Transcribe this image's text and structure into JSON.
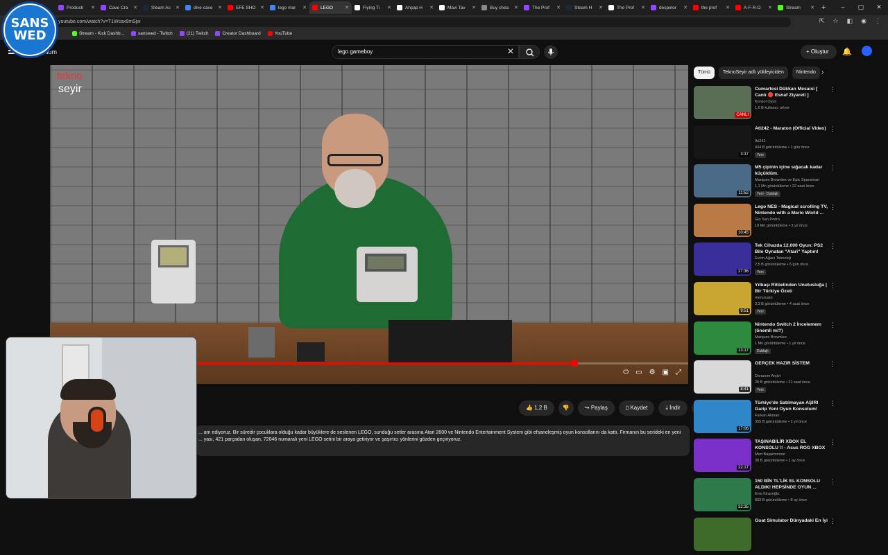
{
  "browser": {
    "tabs": [
      {
        "label": "Producti",
        "color": "#9146ff"
      },
      {
        "label": "Cave Cra",
        "color": "#9146ff"
      },
      {
        "label": "Steam Ac",
        "color": "#1b2838"
      },
      {
        "label": "dive cave",
        "color": "#4285f4"
      },
      {
        "label": "EFE SHO",
        "color": "#ff0000"
      },
      {
        "label": "lego mar",
        "color": "#4285f4"
      },
      {
        "label": "LEGO",
        "color": "#ff0000"
      },
      {
        "label": "Flying Ti",
        "color": "#ffffff"
      },
      {
        "label": "Ahşap H",
        "color": "#ffffff"
      },
      {
        "label": "Mavi Tav",
        "color": "#ffffff"
      },
      {
        "label": "Buy chea",
        "color": "#888888"
      },
      {
        "label": "The Prof",
        "color": "#9146ff"
      },
      {
        "label": "Steam H",
        "color": "#1b2838"
      },
      {
        "label": "The Prof",
        "color": "#ffffff"
      },
      {
        "label": "despelor",
        "color": "#9146ff"
      },
      {
        "label": "the prof",
        "color": "#ff0000"
      },
      {
        "label": "A-F-R-O",
        "color": "#ff0000"
      },
      {
        "label": "Stream",
        "color": "#53fc18"
      }
    ],
    "active_tab_index": 6,
    "url": "youtube.com/watch?v=T1Wcax9mSjw",
    "bookmarks": [
      {
        "label": "Stream - Kick Dashb...",
        "color": "#53fc18"
      },
      {
        "label": "sanswed - Twitch",
        "color": "#9146ff"
      },
      {
        "label": "(21) Twitch",
        "color": "#9146ff"
      },
      {
        "label": "Creator Dashboard",
        "color": "#9146ff"
      },
      {
        "label": "YouTube",
        "color": "#ff0000"
      }
    ]
  },
  "overlay_logo": {
    "line1": "SANS",
    "line2": "WED"
  },
  "youtube": {
    "brand_suffix": "mium",
    "search_value": "lego gameboy",
    "create_label": "Oluştur",
    "channel_watermark": {
      "line1": "tekno",
      "line2": "seyir"
    },
    "progress": 0.822,
    "actions": {
      "likes": "1,2 B",
      "share": "Paylaş",
      "save": "Kaydet",
      "download": "İndir"
    },
    "description": "... am ediyoruz. Bir süredir çocuklara olduğu kadar büyüklere de seslenen LEGO, sunduğu setler arasına Atari 2600 ve Nintendo Entertainment System gibi efsaneleşmiş oyun konsollarını da kattı. Firmanın bu serideki en yeni ... yası, 421 parçadan oluşan, 72046 numaralı yeni LEGO setini bir araya getiriyor ve şaşırtıcı yönlerini gözden geçiriyoruz."
  },
  "sidebar": {
    "chips": [
      "Tümü",
      "TeknoSeyir adlı yükleyiciden",
      "Nintendo"
    ],
    "videos": [
      {
        "title": "Cumartesi Dükkan Mesaisi [ Canlı 🔴 Esnaf Ziyareti ]",
        "channel": "Konsol Oyun",
        "meta": "1,6 B kullanıcı izliyor",
        "duration": "CANLI",
        "badge": "",
        "thumb": "#5a6e55"
      },
      {
        "title": "Ati242 - Maraton (Official Video)",
        "channel": "Ati242",
        "meta": "434 B görüntüleme • 1 gün önce",
        "duration": "3:37",
        "badge": "Yeni",
        "thumb": "#161616"
      },
      {
        "title": "M5 çipinin içine sığacak kadar küçüldüm.",
        "channel": "Marques Brownlee ve Epic Spaceman",
        "meta": "1,1 Mn görüntüleme • 22 saat önce",
        "duration": "11:52",
        "badge": "Yeni · Dublajlı",
        "thumb": "#4a6a88"
      },
      {
        "title": "Lego NES - Magical scrolling TV, Nintendo with a Mario World ...",
        "channel": "Gio San Pedro",
        "meta": "10 Mn görüntüleme • 3 yıl önce",
        "duration": "10:45",
        "badge": "",
        "thumb": "#b97a45"
      },
      {
        "title": "Tek Cihazda 12.000 Oyun: PS2 Bile Oynatan \"Atari\" Yaptım!",
        "channel": "Evrim Ağacı Teknoloji",
        "meta": "2,5 B görüntüleme • 6 gün önce",
        "duration": "27:36",
        "badge": "Yeni",
        "thumb": "#3a2f9a"
      },
      {
        "title": "Yılbaşı Ritüelinden Unutusluğa | Bir Türkiye Özeti",
        "channel": "mervzuato",
        "meta": "3,3 B görüntüleme • 4 saat önce",
        "duration": "9:51",
        "badge": "Yeni",
        "thumb": "#c9a532"
      },
      {
        "title": "Nintendo Switch 2 İncelemem (önemli mi?)",
        "channel": "Marques Brownlee",
        "meta": "1 Mn görüntüleme • 1 yıl önce",
        "duration": "13:17",
        "badge": "Dublajlı",
        "thumb": "#2e8b3e"
      },
      {
        "title": "GERÇEK HAZIR SİSTEM",
        "channel": "Donanım Arşivi",
        "meta": "28 B görüntüleme • 21 saat önce",
        "duration": "8:41",
        "badge": "Yeni",
        "thumb": "#d9d9d9"
      },
      {
        "title": "Türkiye'de Satılmayan AŞIRI Garip Yeni Oyun Konsolum!",
        "channel": "Furkan Akman",
        "meta": "355 B görüntüleme • 1 yıl önce",
        "duration": "17:06",
        "badge": "",
        "thumb": "#2f86c9"
      },
      {
        "title": "TAŞINABİLİR XBOX EL KONSOLU !! - Asus ROG XBOX ...",
        "channel": "Mert Başarmemur",
        "meta": "38 B görüntüleme • 1 ay önce",
        "duration": "22:17",
        "badge": "",
        "thumb": "#7b2fc9"
      },
      {
        "title": "150 BİN TL'LİK EL KONSOLU ALDIK! HEPSİNDE OYUN ...",
        "channel": "Enis Kirazoğlu",
        "meta": "833 B görüntüleme • 8 ay önce",
        "duration": "32:35",
        "badge": "",
        "thumb": "#2e7a4a"
      },
      {
        "title": "Goat Simulator Dünyadaki En İyi",
        "channel": "",
        "meta": "",
        "duration": "",
        "badge": "",
        "thumb": "#3f6b2a"
      }
    ]
  }
}
